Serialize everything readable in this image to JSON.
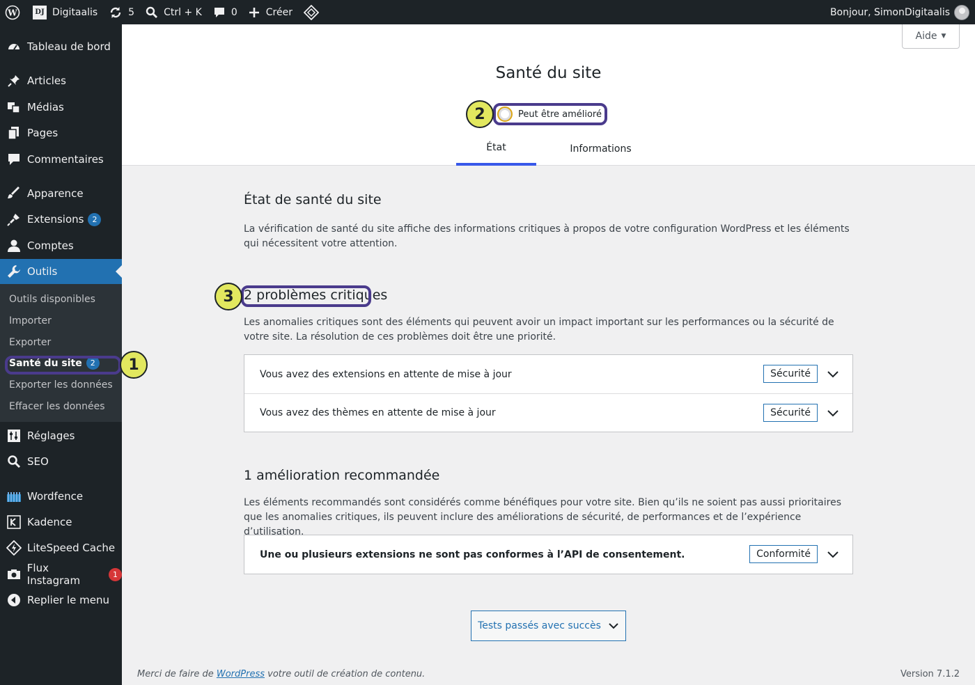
{
  "adminbar": {
    "site_name": "Digitaalis",
    "site_badge": "DJ",
    "updates_count": "5",
    "search_shortcut": "Ctrl + K",
    "comments_count": "0",
    "create_label": "Créer",
    "greeting": "Bonjour, SimonDigitaalis"
  },
  "sidebar": {
    "items": [
      {
        "label": "Tableau de bord",
        "icon": "dashboard-icon"
      },
      {
        "label": "Articles",
        "icon": "pin-icon"
      },
      {
        "label": "Médias",
        "icon": "media-icon"
      },
      {
        "label": "Pages",
        "icon": "pages-icon"
      },
      {
        "label": "Commentaires",
        "icon": "comment-icon"
      },
      {
        "label": "Apparence",
        "icon": "brush-icon"
      },
      {
        "label": "Extensions",
        "icon": "plugin-icon",
        "badge": "2"
      },
      {
        "label": "Comptes",
        "icon": "user-icon"
      },
      {
        "label": "Outils",
        "icon": "wrench-icon"
      },
      {
        "label": "Réglages",
        "icon": "settings-icon"
      },
      {
        "label": "SEO",
        "icon": "search-icon"
      },
      {
        "label": "Wordfence",
        "icon": "wordfence-icon"
      },
      {
        "label": "Kadence",
        "icon": "kadence-icon"
      },
      {
        "label": "LiteSpeed Cache",
        "icon": "litespeed-icon"
      },
      {
        "label": "Flux Instagram",
        "icon": "camera-icon",
        "badge": "1"
      },
      {
        "label": "Replier le menu",
        "icon": "collapse-icon"
      }
    ],
    "submenu": [
      {
        "label": "Outils disponibles"
      },
      {
        "label": "Importer"
      },
      {
        "label": "Exporter"
      },
      {
        "label": "Santé du site",
        "badge": "2"
      },
      {
        "label": "Exporter les données"
      },
      {
        "label": "Effacer les données"
      }
    ]
  },
  "header": {
    "help_label": "Aide",
    "title": "Santé du site",
    "status_label": "Peut être amélioré",
    "tabs": [
      {
        "label": "État"
      },
      {
        "label": "Informations"
      }
    ]
  },
  "annotations": [
    "1",
    "2",
    "3"
  ],
  "main": {
    "intro_title": "État de santé du site",
    "intro_desc": "La vérification de santé du site affiche des informations critiques à propos de votre configuration WordPress et les éléments qui nécessitent votre attention.",
    "critical_title": "2 problèmes critiques",
    "critical_desc": "Les anomalies critiques sont des éléments qui peuvent avoir un impact important sur les performances ou la sécurité de votre site. La résolution de ces problèmes doit être une priorité.",
    "critical_items": [
      {
        "label": "Vous avez des extensions en attente de mise à jour",
        "badge": "Sécurité"
      },
      {
        "label": "Vous avez des thèmes en attente de mise à jour",
        "badge": "Sécurité"
      }
    ],
    "recommended_title": "1 amélioration recommandée",
    "recommended_desc": "Les éléments recommandés sont considérés comme bénéfiques pour votre site. Bien qu’ils ne soient pas aussi prioritaires que les anomalies critiques, ils peuvent inclure des améliorations de sécurité, de performances et de l’expérience d’utilisation.",
    "recommended_items": [
      {
        "label": "Une ou plusieurs extensions ne sont pas conformes à l’API de consentement.",
        "badge": "Conformité"
      }
    ],
    "passed_button": "Tests passés avec succès"
  },
  "footer": {
    "thanks_prefix": "Merci de faire de ",
    "thanks_link": "WordPress",
    "thanks_suffix": " votre outil de création de contenu.",
    "version": "Version 7.1.2"
  },
  "colors": {
    "accent": "#2271b1",
    "tab_active": "#3858e9",
    "callout": "#e2e85f",
    "highlight": "#4a3b8c",
    "warning": "#dba617"
  }
}
